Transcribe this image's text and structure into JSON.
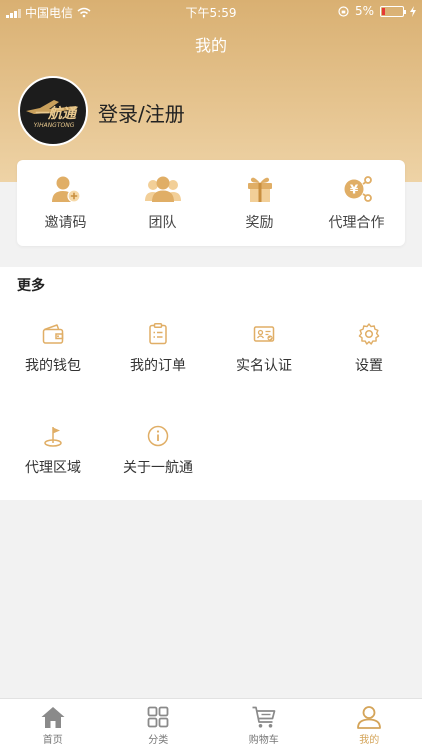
{
  "status_bar": {
    "carrier": "中国电信",
    "time": "下午5:59",
    "battery": "5%"
  },
  "page_title": "我的",
  "profile": {
    "login_label": "登录/注册",
    "logo_text": "一航通",
    "logo_subtext": "YIHANGTONG"
  },
  "quick_actions": [
    {
      "label": "邀请码",
      "icon": "invite-user-icon"
    },
    {
      "label": "团队",
      "icon": "team-icon"
    },
    {
      "label": "奖励",
      "icon": "gift-icon"
    },
    {
      "label": "代理合作",
      "icon": "cooperation-icon"
    }
  ],
  "more": {
    "heading": "更多",
    "items": [
      {
        "label": "我的钱包",
        "icon": "wallet-icon"
      },
      {
        "label": "我的订单",
        "icon": "order-icon"
      },
      {
        "label": "实名认证",
        "icon": "id-card-icon"
      },
      {
        "label": "设置",
        "icon": "settings-icon"
      },
      {
        "label": "代理区域",
        "icon": "region-flag-icon"
      },
      {
        "label": "关于一航通",
        "icon": "info-icon"
      }
    ]
  },
  "tabbar": [
    {
      "label": "首页",
      "icon": "home-icon"
    },
    {
      "label": "分类",
      "icon": "category-icon"
    },
    {
      "label": "购物车",
      "icon": "cart-icon"
    },
    {
      "label": "我的",
      "icon": "profile-icon",
      "active": true
    }
  ],
  "colors": {
    "accent": "#d4a459",
    "header_start": "#d9b072",
    "header_end": "#eed3a6"
  }
}
